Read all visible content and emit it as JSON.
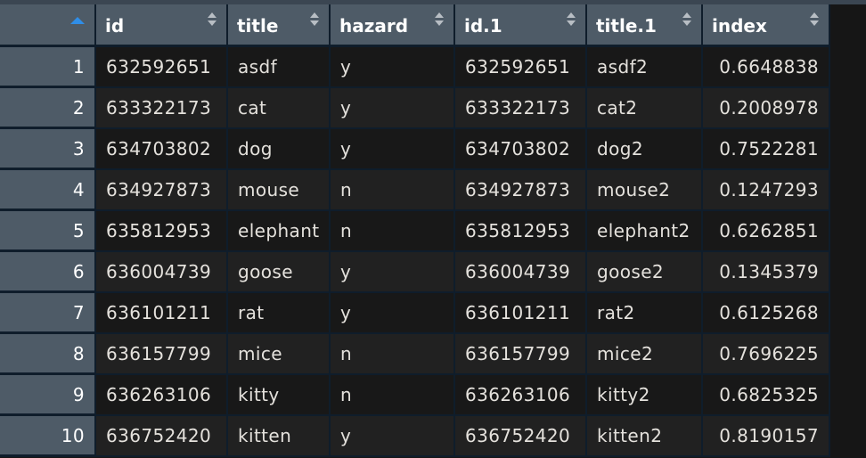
{
  "colors": {
    "header_bg": "#4e5b67",
    "row_odd": "#181818",
    "row_even": "#212121",
    "grid_line": "#0f1d2b",
    "sort_active": "#2f8ee8",
    "text": "#e4e1dc"
  },
  "table": {
    "columns": [
      {
        "key": "id",
        "label": "id"
      },
      {
        "key": "title",
        "label": "title"
      },
      {
        "key": "hazard",
        "label": "hazard"
      },
      {
        "key": "id1",
        "label": "id.1"
      },
      {
        "key": "title1",
        "label": "title.1"
      },
      {
        "key": "index",
        "label": "index"
      }
    ],
    "sorted_by": "row-number",
    "sort_direction": "ascending",
    "rows": [
      {
        "n": "1",
        "id": "632592651",
        "title": "asdf",
        "hazard": "y",
        "id1": "632592651",
        "title1": "asdf2",
        "index": "0.6648838"
      },
      {
        "n": "2",
        "id": "633322173",
        "title": "cat",
        "hazard": "y",
        "id1": "633322173",
        "title1": "cat2",
        "index": "0.2008978"
      },
      {
        "n": "3",
        "id": "634703802",
        "title": "dog",
        "hazard": "y",
        "id1": "634703802",
        "title1": "dog2",
        "index": "0.7522281"
      },
      {
        "n": "4",
        "id": "634927873",
        "title": "mouse",
        "hazard": "n",
        "id1": "634927873",
        "title1": "mouse2",
        "index": "0.1247293"
      },
      {
        "n": "5",
        "id": "635812953",
        "title": "elephant",
        "hazard": "n",
        "id1": "635812953",
        "title1": "elephant2",
        "index": "0.6262851"
      },
      {
        "n": "6",
        "id": "636004739",
        "title": "goose",
        "hazard": "y",
        "id1": "636004739",
        "title1": "goose2",
        "index": "0.1345379"
      },
      {
        "n": "7",
        "id": "636101211",
        "title": "rat",
        "hazard": "y",
        "id1": "636101211",
        "title1": "rat2",
        "index": "0.6125268"
      },
      {
        "n": "8",
        "id": "636157799",
        "title": "mice",
        "hazard": "n",
        "id1": "636157799",
        "title1": "mice2",
        "index": "0.7696225"
      },
      {
        "n": "9",
        "id": "636263106",
        "title": "kitty",
        "hazard": "n",
        "id1": "636263106",
        "title1": "kitty2",
        "index": "0.6825325"
      },
      {
        "n": "10",
        "id": "636752420",
        "title": "kitten",
        "hazard": "y",
        "id1": "636752420",
        "title1": "kitten2",
        "index": "0.8190157"
      }
    ]
  }
}
